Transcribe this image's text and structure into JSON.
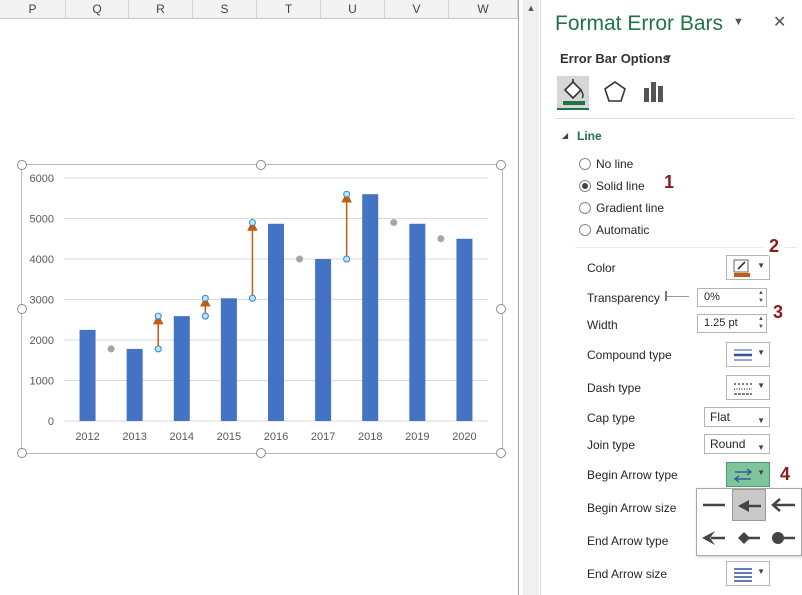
{
  "sheet": {
    "columns": [
      "P",
      "Q",
      "R",
      "S",
      "T",
      "U",
      "V",
      "W"
    ]
  },
  "chart_data": {
    "type": "bar",
    "categories": [
      "2012",
      "2013",
      "2014",
      "2015",
      "2016",
      "2017",
      "2018",
      "2019",
      "2020"
    ],
    "values": [
      2250,
      1780,
      2590,
      3030,
      4870,
      4000,
      5600,
      4870,
      4500
    ],
    "yticks": [
      "0",
      "1000",
      "2000",
      "3000",
      "4000",
      "5000",
      "6000"
    ],
    "ylim": [
      0,
      6000
    ],
    "bar_color": "#4472c4",
    "marker_color": "#a6a6a6",
    "marker_series": {
      "x_between": [
        "2012-2013",
        "2013-2014",
        "2014-2015",
        "2015-2016",
        "2016-2017",
        "2017-2018",
        "2018-2019",
        "2019-2020"
      ],
      "values": [
        1780,
        1780,
        2590,
        3030,
        4000,
        4000,
        4900,
        4500
      ]
    },
    "error_bars": [
      {
        "between": "2013-2014",
        "from": 1780,
        "to": 2590
      },
      {
        "between": "2014-2015",
        "from": 2590,
        "to": 3030
      },
      {
        "between": "2015-2016",
        "from": 3030,
        "to": 4900
      },
      {
        "between": "2017-2018",
        "from": 4000,
        "to": 5600
      }
    ],
    "error_bar_color": "#c55a11",
    "gridlines": true
  },
  "pane": {
    "title": "Format Error Bars",
    "options_title": "Error Bar Options",
    "section": "Line",
    "radios": [
      {
        "label": "No line",
        "selected": false
      },
      {
        "label": "Solid line",
        "selected": true
      },
      {
        "label": "Gradient line",
        "selected": false
      },
      {
        "label": "Automatic",
        "selected": false
      }
    ],
    "color_label": "Color",
    "transparency_label": "Transparency",
    "transparency_value": "0%",
    "width_label": "Width",
    "width_value": "1.25 pt",
    "compound_label": "Compound type",
    "dash_label": "Dash type",
    "cap_label": "Cap type",
    "cap_value": "Flat",
    "join_label": "Join type",
    "join_value": "Round",
    "begin_arrow_type_label": "Begin Arrow type",
    "begin_arrow_size_label": "Begin Arrow size",
    "end_arrow_type_label": "End Arrow type",
    "end_arrow_size_label": "End Arrow size",
    "accent_color": "#217346",
    "line_color_swatch": "#c55a11"
  },
  "badges": [
    "1",
    "2",
    "3",
    "4"
  ]
}
